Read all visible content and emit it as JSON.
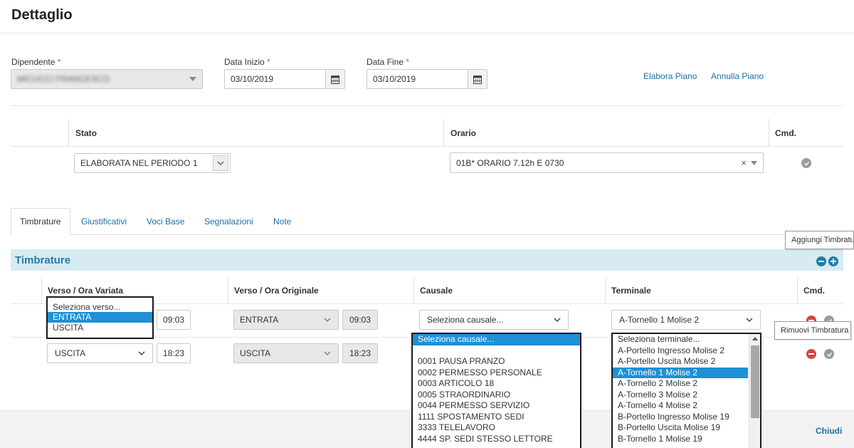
{
  "page": {
    "title": "Dettaglio"
  },
  "filters": {
    "employee_label": "Dipendente",
    "employee_value": "MICUCCI FRANCESCO",
    "start_label": "Data Inizio",
    "start_value": "03/10/2019",
    "end_label": "Data Fine",
    "end_value": "03/10/2019",
    "required_mark": "*"
  },
  "actions": {
    "elabora": "Elabora Piano",
    "annulla": "Annulla Piano"
  },
  "plan_table": {
    "headers": {
      "stato": "Stato",
      "orario": "Orario",
      "cmd": "Cmd."
    },
    "stato_value": "ELABORATA NEL PERIODO 1",
    "orario_value": "01B* ORARIO 7.12h E 0730",
    "clear_glyph": "×"
  },
  "tabs": [
    {
      "label": "Timbrature"
    },
    {
      "label": "Giustificativi"
    },
    {
      "label": "Voci Base"
    },
    {
      "label": "Segnalazioni"
    },
    {
      "label": "Note"
    }
  ],
  "section": {
    "title": "Timbrature",
    "tooltip_add": "Aggiungi Timbratura",
    "tooltip_remove": "Rimuovi Timbratura"
  },
  "stamps_table": {
    "headers": {
      "verso_variata": "Verso / Ora Variata",
      "verso_originale": "Verso / Ora Originale",
      "causale": "Causale",
      "terminale": "Terminale",
      "cmd": "Cmd."
    },
    "rows": [
      {
        "verso_variata": "Seleziona verso...",
        "ora_variata": "09:03",
        "verso_originale": "ENTRATA",
        "ora_originale": "09:03",
        "causale": "Seleziona causale...",
        "terminale": "A-Tornello 1 Molise 2"
      },
      {
        "verso_variata": "USCITA",
        "ora_variata": "18:23",
        "verso_originale": "USCITA",
        "ora_originale": "18:23",
        "causale": "",
        "terminale": ""
      }
    ]
  },
  "verso_dropdown": {
    "options": [
      "Seleziona verso...",
      "ENTRATA",
      "USCITA"
    ],
    "selected": "ENTRATA"
  },
  "causale_dropdown": {
    "options": [
      "Seleziona causale...",
      "",
      "0001 PAUSA PRANZO",
      "0002 PERMESSO PERSONALE",
      "0003 ARTICOLO 18",
      "0005 STRAORDINARIO",
      "0044 PERMESSO SERVIZIO",
      "1111 SPOSTAMENTO SEDI",
      "3333 TELELAVORO",
      "4444 SP. SEDI STESSO LETTORE"
    ],
    "selected": "Seleziona causale..."
  },
  "terminale_dropdown": {
    "options": [
      "Seleziona terminale...",
      "A-Portello Ingresso Molise 2",
      "A-Portello Uscita Molise 2",
      "A-Tornello 1 Molise 2",
      "A-Tornello 2 Molise 2",
      "A-Tornello 3 Molise 2",
      "A-Tornello 4 Molise 2",
      "B-Portello Ingresso Molise 19",
      "B-Portello Uscita Molise 19",
      "B-Tornello 1 Molise 19"
    ],
    "selected": "A-Tornello 1 Molise 2"
  },
  "footer": {
    "close": "Chiudi"
  },
  "colors": {
    "accent": "#1a6fa6",
    "banner": "#d7ebf4",
    "selected": "#1e90d6",
    "danger": "#d64541"
  }
}
